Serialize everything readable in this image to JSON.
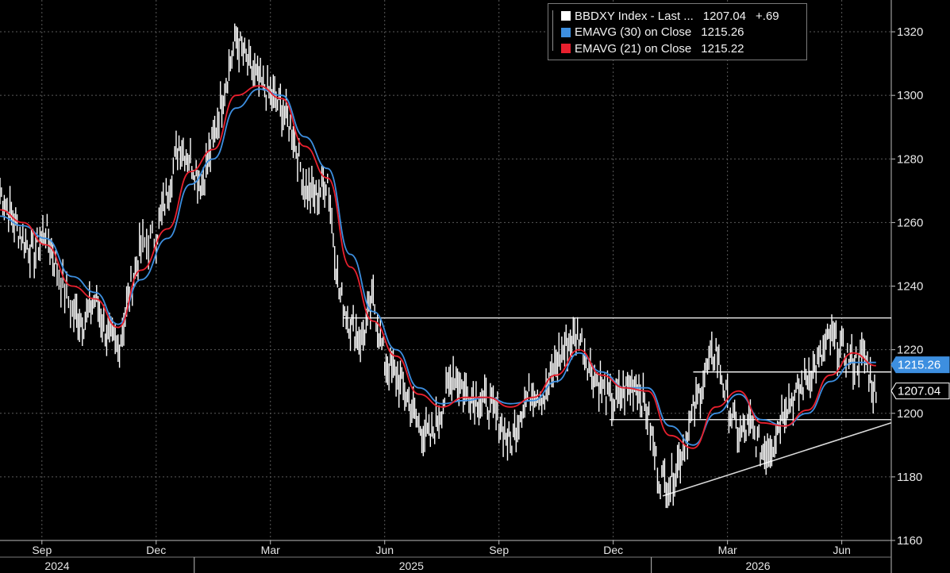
{
  "chart_data": {
    "type": "line",
    "legend": {
      "placement": "top-right",
      "entries": [
        {
          "label": "BBDXY Index - Last ...",
          "value": "1207.04",
          "change": "+.69",
          "color": "#ffffff"
        },
        {
          "label": "EMAVG (30)  on Close",
          "value": "1215.26",
          "change": "",
          "color": "#3d8fe0"
        },
        {
          "label": "EMAVG (21)  on Close",
          "value": "1215.22",
          "change": "",
          "color": "#e8202e"
        }
      ]
    },
    "ylim": [
      1160,
      1330
    ],
    "y_ticks": [
      1160,
      1180,
      1200,
      1220,
      1240,
      1260,
      1280,
      1300,
      1320
    ],
    "x_ticks": [
      "Sep",
      "Dec",
      "Mar",
      "Jun",
      "Sep",
      "Dec",
      "Mar",
      "Jun"
    ],
    "years": [
      "2024",
      "2025",
      "2026"
    ],
    "x_range_months": [
      0,
      23.4
    ],
    "x_tick_months": [
      1.1,
      4.1,
      7.1,
      10.1,
      13.1,
      16.1,
      19.1,
      22.1
    ],
    "year_divider_months": [
      5.1,
      17.1
    ],
    "year_label_months": [
      1.5,
      10.8,
      19.9
    ],
    "series": [
      {
        "name": "BBDXY Index",
        "color": "#ffffff",
        "x": [
          0,
          0.3,
          0.6,
          0.9,
          1.2,
          1.5,
          1.9,
          2.2,
          2.5,
          2.8,
          3.1,
          3.4,
          3.7,
          4.1,
          4.4,
          4.7,
          5.0,
          5.3,
          5.6,
          5.9,
          6.2,
          6.5,
          6.8,
          7.1,
          7.4,
          7.7,
          8.0,
          8.3,
          8.6,
          8.9,
          9.2,
          9.5,
          9.8,
          10.1,
          10.4,
          10.7,
          11.0,
          11.3,
          11.6,
          11.9,
          12.2,
          12.5,
          12.8,
          13.1,
          13.4,
          13.7,
          14.0,
          14.3,
          14.6,
          14.9,
          15.2,
          15.5,
          15.8,
          16.1,
          16.4,
          16.7,
          17.0,
          17.3,
          17.6,
          17.9,
          18.2,
          18.5,
          18.8,
          19.1,
          19.4,
          19.7,
          20.0,
          20.3,
          20.6,
          20.9,
          21.2,
          21.5,
          21.8,
          22.1,
          22.4,
          22.7,
          23.0
        ],
        "y": [
          1270,
          1262,
          1255,
          1250,
          1258,
          1245,
          1232,
          1229,
          1236,
          1225,
          1220,
          1238,
          1252,
          1256,
          1270,
          1285,
          1280,
          1272,
          1286,
          1303,
          1318,
          1310,
          1304,
          1300,
          1296,
          1288,
          1271,
          1268,
          1274,
          1238,
          1228,
          1223,
          1236,
          1216,
          1212,
          1205,
          1196,
          1192,
          1202,
          1213,
          1207,
          1205,
          1203,
          1198,
          1190,
          1202,
          1208,
          1205,
          1216,
          1222,
          1225,
          1214,
          1208,
          1203,
          1207,
          1210,
          1200,
          1180,
          1178,
          1188,
          1200,
          1212,
          1220,
          1203,
          1193,
          1196,
          1188,
          1191,
          1203,
          1205,
          1212,
          1216,
          1224,
          1220,
          1216,
          1218,
          1205
        ]
      },
      {
        "name": "EMAVG (30)",
        "color": "#3d8fe0",
        "x": [
          0,
          0.6,
          1.2,
          1.9,
          2.5,
          3.1,
          3.7,
          4.4,
          5.0,
          5.6,
          6.2,
          6.8,
          7.4,
          8.0,
          8.6,
          9.2,
          9.8,
          10.4,
          11.0,
          11.6,
          12.2,
          12.8,
          13.4,
          14.0,
          14.6,
          15.2,
          15.8,
          16.4,
          17.0,
          17.6,
          18.2,
          18.8,
          19.4,
          20.0,
          20.6,
          21.2,
          21.8,
          22.4,
          23.0
        ],
        "y": [
          1262,
          1259,
          1255,
          1243,
          1238,
          1228,
          1242,
          1255,
          1272,
          1280,
          1296,
          1302,
          1300,
          1287,
          1277,
          1250,
          1232,
          1220,
          1208,
          1203,
          1204,
          1205,
          1203,
          1204,
          1210,
          1219,
          1213,
          1208,
          1208,
          1196,
          1190,
          1200,
          1206,
          1198,
          1196,
          1200,
          1210,
          1216,
          1216
        ]
      },
      {
        "name": "EMAVG (21)",
        "color": "#e8202e",
        "x": [
          0,
          0.6,
          1.2,
          1.9,
          2.5,
          3.1,
          3.7,
          4.4,
          5.0,
          5.6,
          6.2,
          6.8,
          7.4,
          8.0,
          8.6,
          9.2,
          9.8,
          10.4,
          11.0,
          11.6,
          12.2,
          12.8,
          13.4,
          14.0,
          14.6,
          15.2,
          15.8,
          16.4,
          17.0,
          17.6,
          18.2,
          18.8,
          19.4,
          20.0,
          20.6,
          21.2,
          21.8,
          22.4,
          23.0
        ],
        "y": [
          1264,
          1260,
          1253,
          1240,
          1236,
          1227,
          1245,
          1258,
          1276,
          1283,
          1300,
          1303,
          1299,
          1284,
          1274,
          1246,
          1229,
          1218,
          1206,
          1202,
          1205,
          1205,
          1202,
          1205,
          1212,
          1220,
          1212,
          1208,
          1207,
          1193,
          1189,
          1202,
          1207,
          1197,
          1196,
          1201,
          1212,
          1219,
          1215
        ]
      }
    ],
    "annotations": [
      {
        "type": "hline",
        "y": 1230,
        "x_from": 9.0,
        "x_to": 23.4
      },
      {
        "type": "hline",
        "y": 1213,
        "x_from": 18.2,
        "x_to": 23.4
      },
      {
        "type": "hline",
        "y": 1198,
        "x_from": 16.0,
        "x_to": 23.4
      },
      {
        "type": "trendline",
        "x1": 17.4,
        "y1": 1174,
        "x2": 23.4,
        "y2": 1197
      }
    ],
    "price_tags": [
      {
        "label": "1215.26",
        "y": 1215.26,
        "bg": "#3d8fe0",
        "fg": "#ffffff"
      },
      {
        "label": "1207.04",
        "y": 1207.04,
        "bg": "#000000",
        "fg": "#ffffff"
      }
    ]
  }
}
